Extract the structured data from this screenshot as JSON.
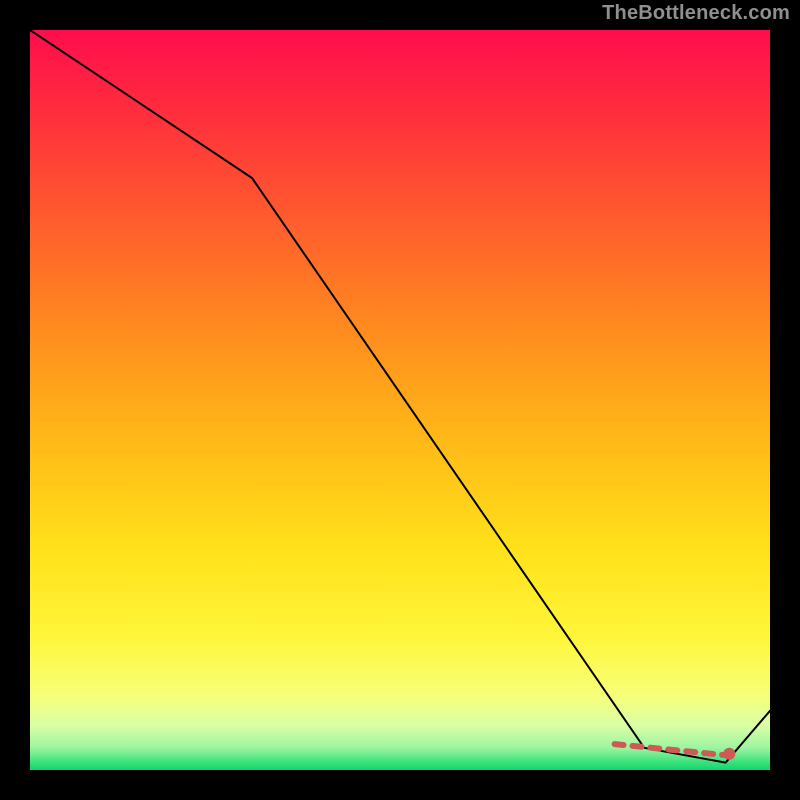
{
  "attribution": "TheBottleneck.com",
  "chart_data": {
    "type": "line",
    "title": "",
    "xlabel": "",
    "ylabel": "",
    "xlim": [
      0,
      100
    ],
    "ylim": [
      0,
      100
    ],
    "grid": false,
    "series": [
      {
        "name": "curve",
        "color": "#000000",
        "x": [
          0,
          30,
          83,
          94,
          100
        ],
        "values": [
          100,
          80,
          3,
          1,
          8
        ]
      }
    ],
    "annotations": [
      {
        "type": "dashed-segment",
        "x0": 79,
        "y0": 3.5,
        "x1": 94,
        "y1": 2,
        "color": "#ce5a55"
      },
      {
        "type": "point",
        "x": 94.5,
        "y": 2.2,
        "color": "#ce5a55"
      }
    ]
  }
}
